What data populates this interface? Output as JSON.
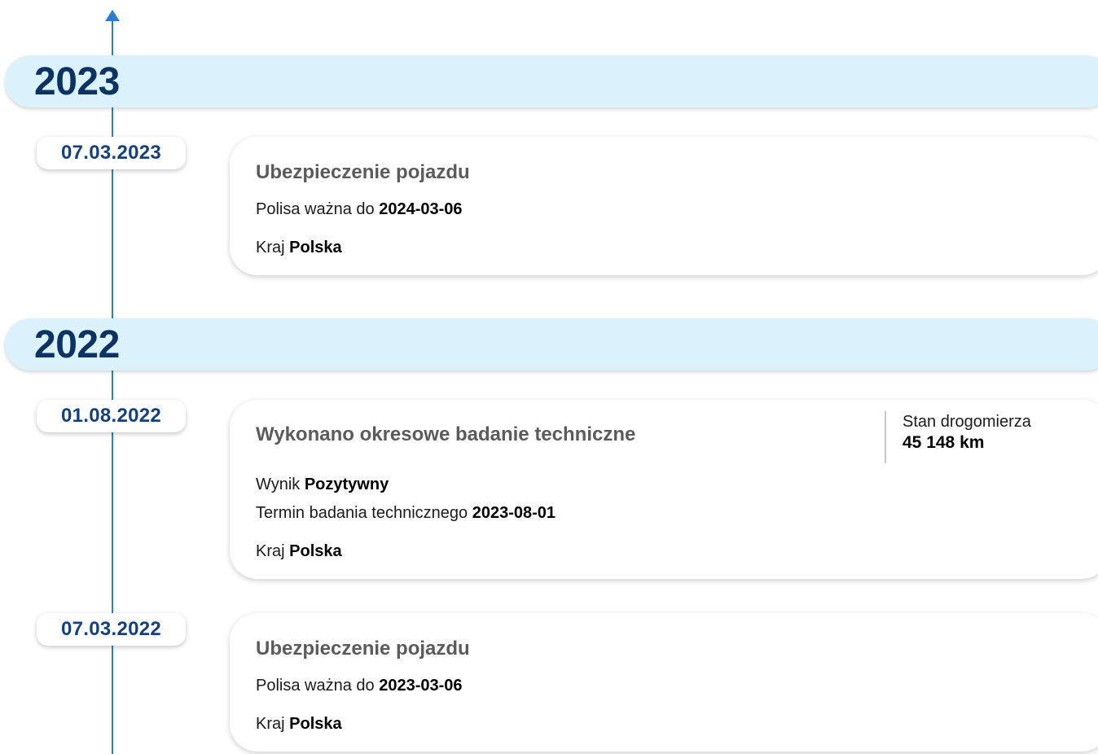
{
  "timeline": {
    "years": [
      {
        "label": "2023"
      },
      {
        "label": "2022"
      }
    ],
    "events": [
      {
        "date": "07.03.2023",
        "title": "Ubezpieczenie pojazdu",
        "policy_label": "Polisa ważna do",
        "policy_value": "2024-03-06",
        "country_label": "Kraj",
        "country_value": "Polska"
      },
      {
        "date": "01.08.2022",
        "title": "Wykonano okresowe badanie techniczne",
        "result_label": "Wynik",
        "result_value": "Pozytywny",
        "term_label": "Termin badania technicznego",
        "term_value": "2023-08-01",
        "country_label": "Kraj",
        "country_value": "Polska",
        "odometer_label": "Stan drogomierza",
        "odometer_value": "45 148 km"
      },
      {
        "date": "07.03.2022",
        "title": "Ubezpieczenie pojazdu",
        "policy_label": "Polisa ważna do",
        "policy_value": "2023-03-06",
        "country_label": "Kraj",
        "country_value": "Polska"
      }
    ]
  },
  "colors": {
    "axis": "#2a7fd4",
    "year_band": "#dbf2fd",
    "year_text": "#0c3363",
    "date_text": "#16407a",
    "title_text": "#5b5b5b"
  },
  "icons": {
    "axis_arrow": "arrow-up-icon"
  }
}
